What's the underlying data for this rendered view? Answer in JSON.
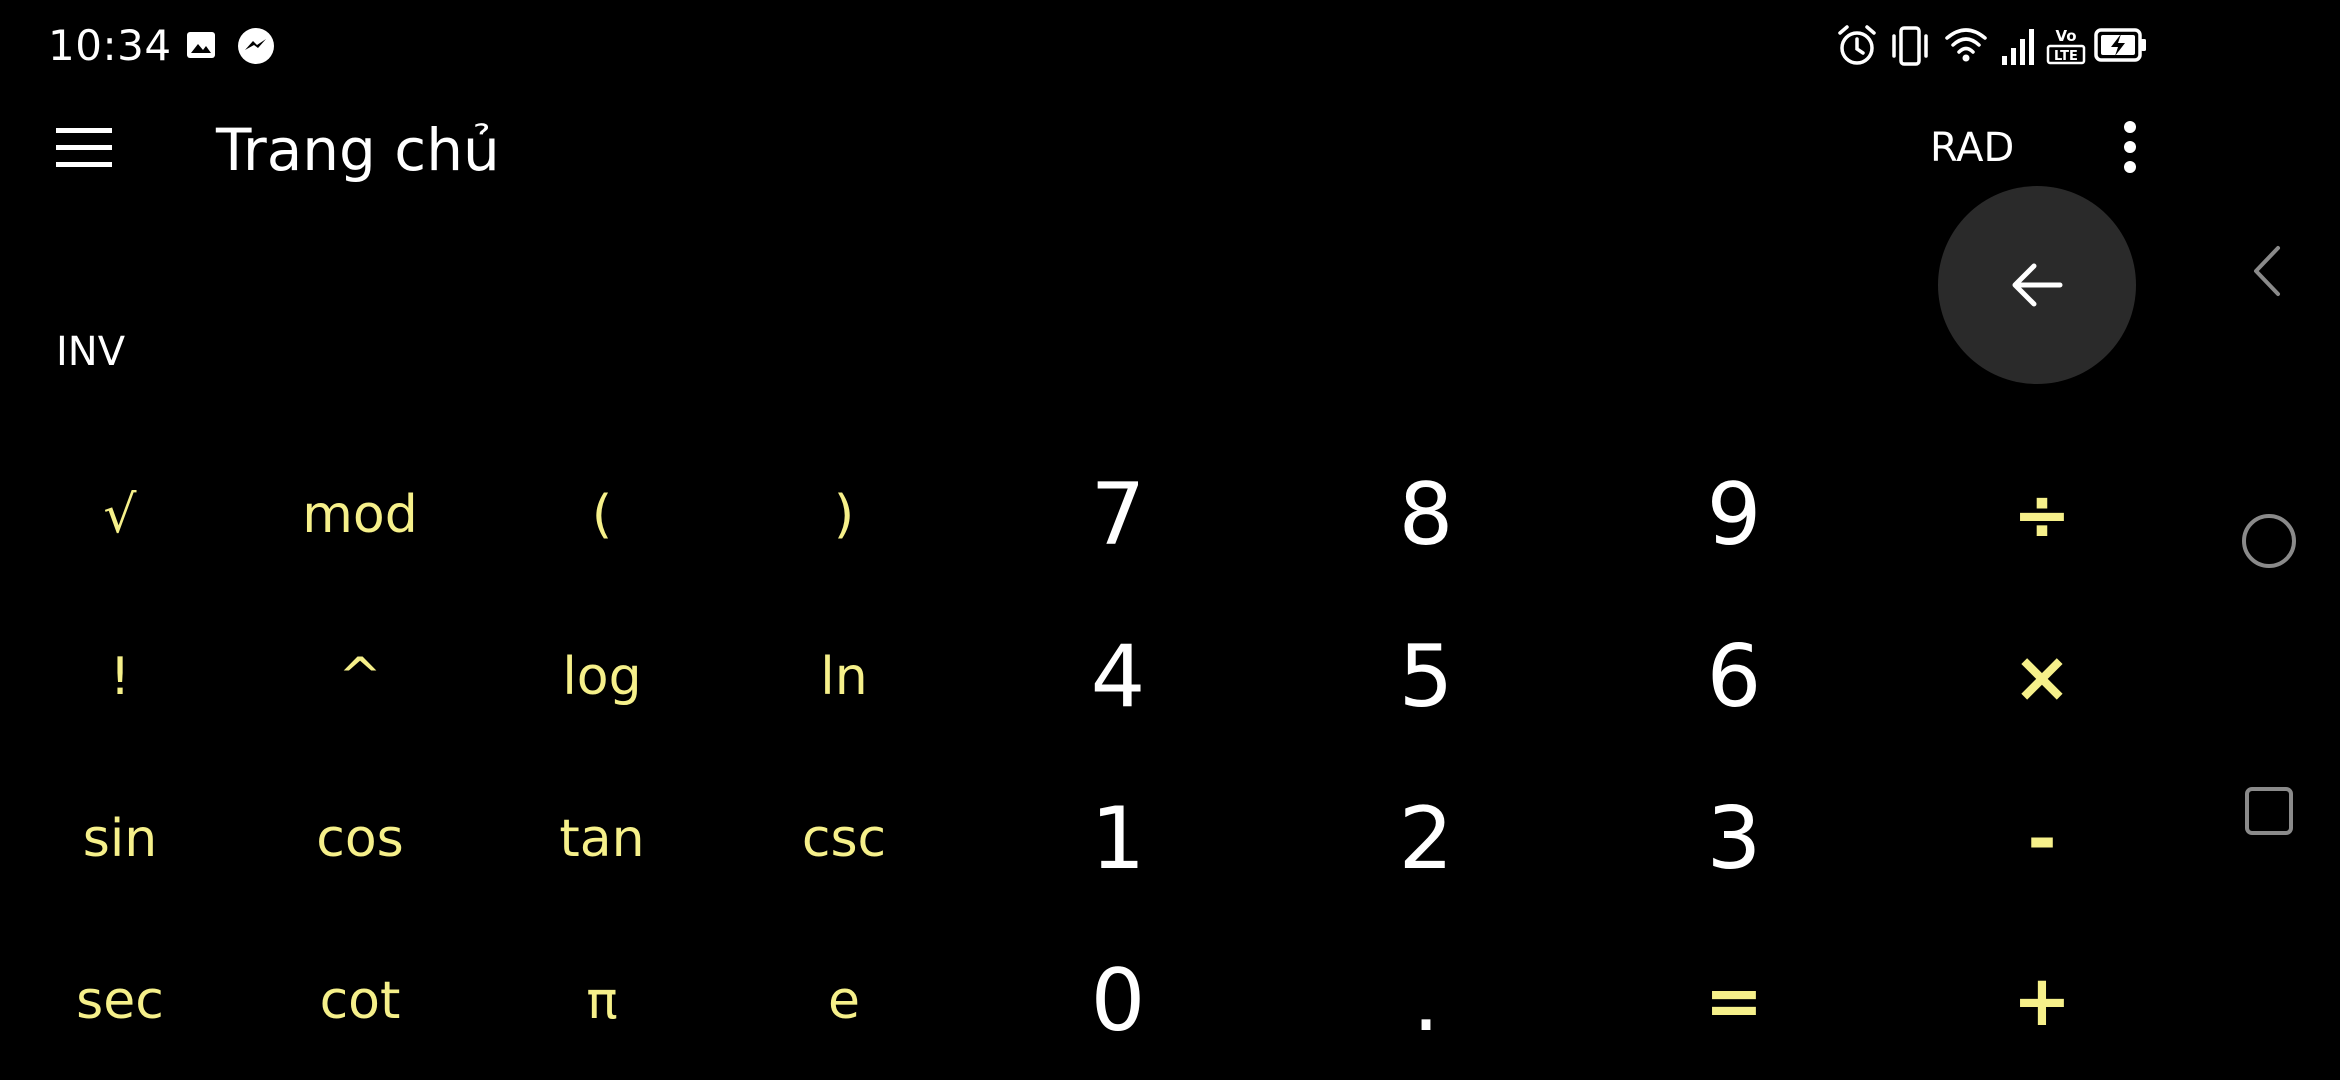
{
  "status_bar": {
    "time": "10:34",
    "left_icons": [
      "image-icon",
      "messenger-icon"
    ],
    "right_icons": [
      "alarm-icon",
      "vibrate-icon",
      "wifi-icon",
      "signal-icon",
      "volte-lte-icon",
      "battery-charging-icon"
    ]
  },
  "app_bar": {
    "menu_icon": "hamburger-menu-icon",
    "title": "Trang chủ",
    "angle_mode": "RAD",
    "overflow_icon": "more-vert-icon"
  },
  "display": {
    "inv_label": "INV",
    "backspace_icon": "backspace-arrow-icon"
  },
  "keypad": {
    "functions": [
      [
        "√",
        "mod",
        "(",
        ")"
      ],
      [
        "!",
        "^",
        "log",
        "ln"
      ],
      [
        "sin",
        "cos",
        "tan",
        "csc"
      ],
      [
        "sec",
        "cot",
        "π",
        "e"
      ]
    ],
    "digits": [
      [
        "7",
        "8",
        "9"
      ],
      [
        "4",
        "5",
        "6"
      ],
      [
        "1",
        "2",
        "3"
      ],
      [
        "0",
        ".",
        "="
      ]
    ],
    "operators": [
      "÷",
      "×",
      "-",
      "+"
    ]
  },
  "nav_bar": {
    "icons": [
      "back-icon",
      "home-icon",
      "recents-icon"
    ]
  },
  "colors": {
    "background": "#000000",
    "accent_yellow": "#f6f08a",
    "text_white": "#ffffff",
    "backspace_circle": "#2a2a2a",
    "nav_icon": "#8a8a8a"
  }
}
